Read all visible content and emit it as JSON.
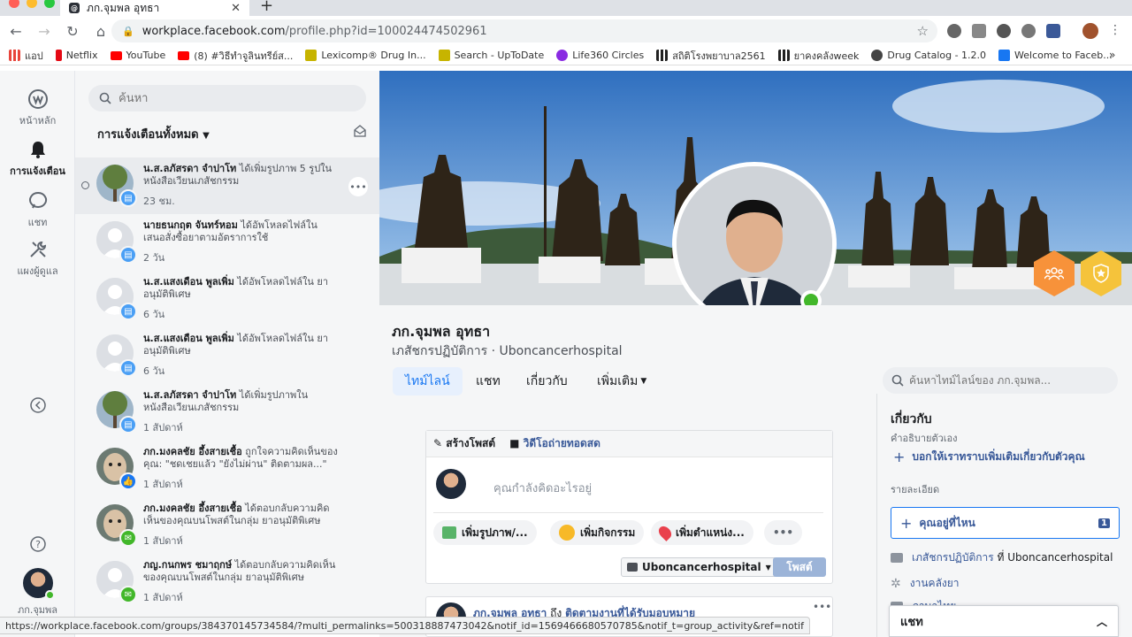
{
  "browser": {
    "tab_title": "ภก.จุมพล อุทธา",
    "url_host": "workplace.facebook.com",
    "url_path": "/profile.php?id=100024474502961",
    "bookmarks": [
      {
        "label": "แอป",
        "icon": "apps-grid-icon",
        "color": "#e8453c"
      },
      {
        "label": "Netflix",
        "icon": "netflix-icon",
        "color": "#e50914"
      },
      {
        "label": "YouTube",
        "icon": "youtube-icon",
        "color": "#ff0000"
      },
      {
        "label": "(8) #วิธีทำจูลินทรีย์ส...",
        "icon": "youtube-icon",
        "color": "#ff0000"
      },
      {
        "label": "Lexicomp® Drug In...",
        "icon": "lexicomp-icon",
        "color": "#c7b400"
      },
      {
        "label": "Search - UpToDate",
        "icon": "uptodate-icon",
        "color": "#c7b400"
      },
      {
        "label": "Life360 Circles",
        "icon": "life360-icon",
        "color": "#8a2be2"
      },
      {
        "label": "สถิติโรงพยาบาล2561",
        "icon": "bar-chart-icon",
        "color": "#222222"
      },
      {
        "label": "ยาคงคลังweek",
        "icon": "bar-chart-icon",
        "color": "#222222"
      },
      {
        "label": "Drug Catalog - 1.2.0",
        "icon": "globe-icon",
        "color": "#444444"
      },
      {
        "label": "Welcome to Faceb...",
        "icon": "facebook-icon",
        "color": "#1877f2"
      }
    ],
    "status_url": "https://workplace.facebook.com/groups/384370145734584/?multi_permalinks=500318887473042&notif_id=1569466680570785&notif_t=group_activity&ref=notif"
  },
  "rail": {
    "home": "หน้าหลัก",
    "notifications": "การแจ้งเตือน",
    "chat": "แชท",
    "admin": "แผงผู้ดูแล",
    "profile": "ภก.จุมพล"
  },
  "notifications": {
    "search_placeholder": "ค้นหา",
    "header": "การแจ้งเตือนทั้งหมด",
    "items": [
      {
        "actor": "น.ส.ลภัสรดา จำปาโท",
        "text": " ได้เพิ่มรูปภาพ 5 รูปใน หนังสือเวียนเภสัชกรรม",
        "time": "23 ชม.",
        "avatar": "tree",
        "badge": "doc",
        "badge_color": "#4a9ff5"
      },
      {
        "actor": "นายธนกฤต จันทร์หอม",
        "text": " ได้อัพโหลดไฟล์ใน เสนอสั่งซื้อยาตามอัตราการใช้",
        "time": "2 วัน",
        "avatar": "blank",
        "badge": "doc",
        "badge_color": "#4a9ff5"
      },
      {
        "actor": "น.ส.แสงเดือน พูลเพิ่ม",
        "text": " ได้อัพโหลดไฟล์ใน ยาอนุมัติพิเศษ",
        "time": "6 วัน",
        "avatar": "blank",
        "badge": "doc",
        "badge_color": "#4a9ff5"
      },
      {
        "actor": "น.ส.แสงเดือน พูลเพิ่ม",
        "text": " ได้อัพโหลดไฟล์ใน ยาอนุมัติพิเศษ",
        "time": "6 วัน",
        "avatar": "blank",
        "badge": "doc",
        "badge_color": "#4a9ff5"
      },
      {
        "actor": "น.ส.ลภัสรดา จำปาโท",
        "text": " ได้เพิ่มรูปภาพใน หนังสือเวียนเภสัชกรรม",
        "time": "1 สัปดาห์",
        "avatar": "tree",
        "badge": "doc",
        "badge_color": "#4a9ff5"
      },
      {
        "actor": "ภก.มงคลชัย อึ้งสายเชื้อ",
        "text": " ถูกใจความคิดเห็นของคุณ: \"ชดเชยแล้ว \"ยังไม่ผ่าน\" ติดตามผล...\"",
        "time": "1 สัปดาห์",
        "avatar": "face",
        "badge": "like",
        "badge_color": "#1877f2"
      },
      {
        "actor": "ภก.มงคลชัย อึ้งสายเชื้อ",
        "text": " ได้ตอบกลับความคิดเห็นของคุณบนโพสต์ในกลุ่ม ยาอนุมัติพิเศษ",
        "time": "1 สัปดาห์",
        "avatar": "face",
        "badge": "comment",
        "badge_color": "#42b72a"
      },
      {
        "actor": "ภญ.กนกพร ชมาฤกษ์",
        "text": " ได้ตอบกลับความคิดเห็นของคุณบนโพสต์ในกลุ่ม ยาอนุมัติพิเศษ",
        "time": "1 สัปดาห์",
        "avatar": "blank",
        "badge": "comment",
        "badge_color": "#42b72a"
      }
    ]
  },
  "profile": {
    "name": "ภก.จุมพล อุทธา",
    "subtitle": "เภสัชกรปฏิบัติการ · Uboncancerhospital",
    "tabs": [
      "ไทม์ไลน์",
      "แชท",
      "เกี่ยวกับ",
      "เพิ่มเติม"
    ],
    "timeline_search_placeholder": "ค้นหาไทม์ไลน์ของ ภก.จุมพล...",
    "composer": {
      "create_post": "สร้างโพสต์",
      "live_video": "วิดีโอถ่ายทอดสด",
      "prompt": "คุณกำลังคิดอะไรอยู่",
      "photo": "เพิ่มรูปภาพ/...",
      "activity": "เพิ่มกิจกรรม",
      "location": "เพิ่มตำแหน่ง...",
      "more": "•••",
      "audience": "Uboncancerhospital",
      "post": "โพสต์"
    },
    "feed_post": {
      "author": "ภก.จุมพล อุทธา",
      "to": "ถึง",
      "target": "ติดตามงานที่ได้รับมอบหมาย"
    },
    "about": {
      "title": "เกี่ยวกับ",
      "self_desc": "คำอธิบายตัวเอง",
      "add_more": "บอกให้เราทราบเพิ่มเติมเกี่ยวกับตัวคุณ",
      "details": "รายละเอียด",
      "where": "คุณอยู่ที่ไหน",
      "where_count": "1",
      "job_title": "เภสัชกรปฏิบัติการ",
      "job_at": " ที่ Uboncancerhospital",
      "dept": "งานคลังยา",
      "extra": "ภาษาไทย"
    }
  },
  "chat": {
    "label": "แชท"
  },
  "colors": {
    "accent": "#1877f2",
    "online": "#42b72a",
    "badge_orange": "#f7923a",
    "badge_gold": "#f5c33b"
  }
}
